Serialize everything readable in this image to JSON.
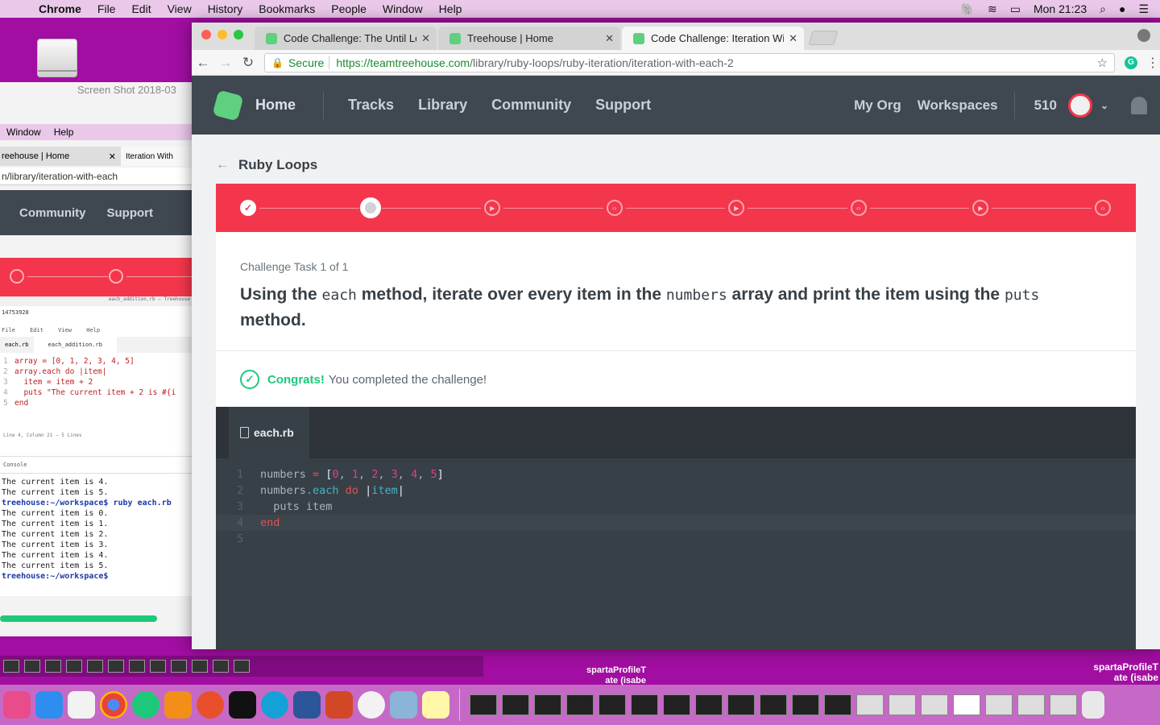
{
  "menubar": {
    "app": "Chrome",
    "items": [
      "File",
      "Edit",
      "View",
      "History",
      "Bookmarks",
      "People",
      "Window",
      "Help"
    ],
    "clock": "Mon 21:23"
  },
  "desktop": {
    "screenshot_file": "Screen Shot 2018-03",
    "names": [
      "spartaProfileT\nate (isabe",
      "spartaProfileT\nate (isabe"
    ]
  },
  "bg_window": {
    "menu": [
      "Window",
      "Help"
    ],
    "tab1": "reehouse | Home",
    "tab2": "Iteration With",
    "url": "n/library/iteration-with-each",
    "nav": [
      "Community",
      "Support"
    ],
    "ws_title": "each_addition.rb — Treehouse",
    "ws_id": "14753928",
    "ws_menu": [
      "File",
      "Edit",
      "View",
      "Help"
    ],
    "ws_tabs": [
      "each.rb",
      "each_addition.rb"
    ],
    "ws_code": [
      {
        "n": "1",
        "t": "array = [0, 1, 2, 3, 4, 5]"
      },
      {
        "n": "2",
        "t": "array.each do |item|"
      },
      {
        "n": "3",
        "t": "  item = item + 2"
      },
      {
        "n": "4",
        "t": "  puts \"The current item + 2 is #{i"
      },
      {
        "n": "5",
        "t": "end"
      }
    ],
    "ws_status": "Line 4, Column 21 — 5 Lines",
    "ws_console": "Console",
    "console_lines": [
      "The current item is 4.",
      "The current item is 5.",
      "treehouse:~/workspace$ ruby each.rb",
      "The current item is 0.",
      "The current item is 1.",
      "The current item is 2.",
      "The current item is 3.",
      "The current item is 4.",
      "The current item is 5.",
      "treehouse:~/workspace$"
    ]
  },
  "tabs": [
    {
      "label": "Code Challenge: The Until Loo",
      "active": false
    },
    {
      "label": "Treehouse | Home",
      "active": false
    },
    {
      "label": "Code Challenge: Iteration With",
      "active": true
    }
  ],
  "omnibar": {
    "secure_label": "Secure",
    "url_host": "https://teamtreehouse.com",
    "url_path": "/library/ruby-loops/ruby-iteration/iteration-with-each-2"
  },
  "nav": {
    "home": "Home",
    "links": [
      "Tracks",
      "Library",
      "Community",
      "Support"
    ],
    "right_links": [
      "My Org",
      "Workspaces"
    ],
    "points": "510"
  },
  "breadcrumb": "Ruby Loops",
  "progress": {
    "total_steps": 8,
    "current_step": 2,
    "completed_steps": 1,
    "step_kinds": [
      "check",
      "current",
      "video",
      "code",
      "video",
      "code",
      "video",
      "code"
    ]
  },
  "challenge": {
    "label": "Challenge Task 1 of 1",
    "q_parts": [
      {
        "t": "Using the ",
        "code": false
      },
      {
        "t": "each",
        "code": true
      },
      {
        "t": " method, iterate over every item in the ",
        "code": false
      },
      {
        "t": "numbers",
        "code": true
      },
      {
        "t": " array and print the item using the ",
        "code": false
      },
      {
        "t": "puts",
        "code": true
      },
      {
        "t": " method.",
        "code": false
      }
    ]
  },
  "congrats": {
    "title": "Congrats!",
    "text": "You completed the challenge!"
  },
  "editor": {
    "filename": "each.rb",
    "lines": [
      {
        "n": "1",
        "tokens": [
          [
            "numbers",
            ""
          ],
          [
            " = ",
            "k-red"
          ],
          [
            "[",
            "k-white"
          ],
          [
            "0",
            "k-pink"
          ],
          [
            ", ",
            ""
          ],
          [
            "1",
            "k-pink"
          ],
          [
            ", ",
            ""
          ],
          [
            "2",
            "k-pink"
          ],
          [
            ", ",
            ""
          ],
          [
            "3",
            "k-pink"
          ],
          [
            ", ",
            ""
          ],
          [
            "4",
            "k-pink"
          ],
          [
            ", ",
            ""
          ],
          [
            "5",
            "k-pink"
          ],
          [
            "]",
            "k-white"
          ]
        ]
      },
      {
        "n": "2",
        "tokens": [
          [
            "numbers",
            ""
          ],
          [
            ".each",
            "k-teal"
          ],
          [
            " do",
            "k-red"
          ],
          [
            " |",
            "k-white"
          ],
          [
            "item",
            "k-teal"
          ],
          [
            "|",
            "k-white"
          ]
        ]
      },
      {
        "n": "3",
        "tokens": [
          [
            "  puts item",
            ""
          ]
        ]
      },
      {
        "n": "4",
        "tokens": [
          [
            "end",
            "k-red"
          ]
        ],
        "highlight": true
      },
      {
        "n": "5",
        "tokens": []
      }
    ]
  }
}
